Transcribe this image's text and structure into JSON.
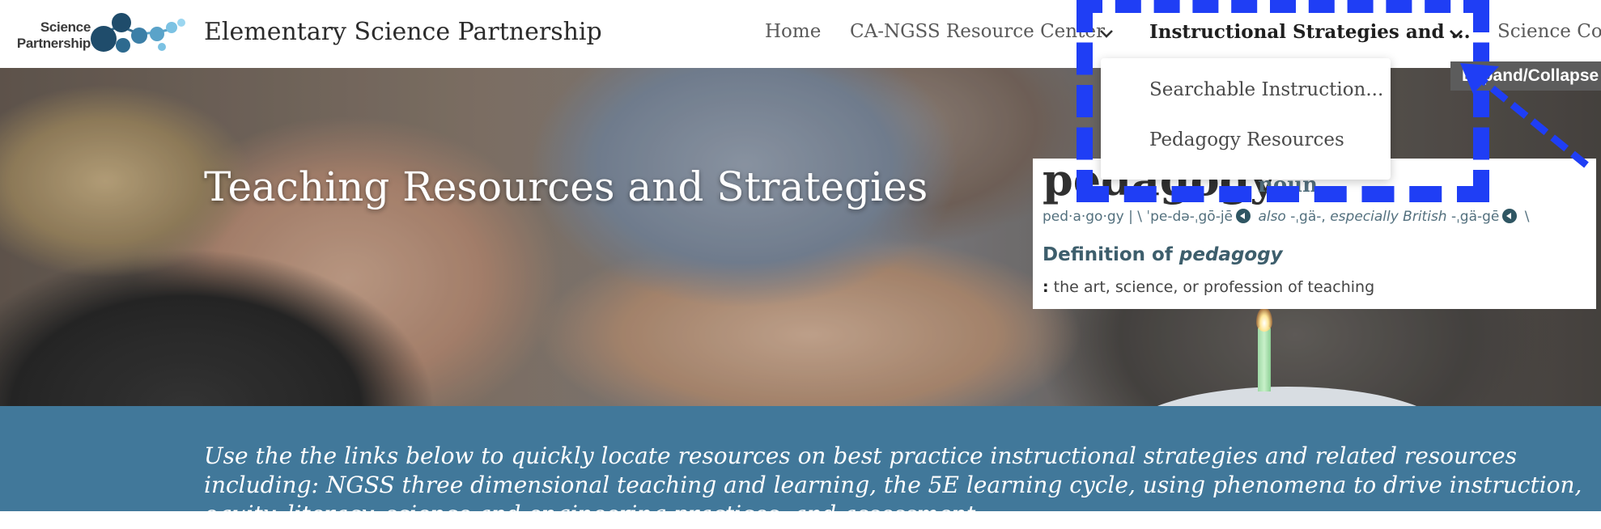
{
  "header": {
    "logo_line1": "Science",
    "logo_line2": "Partnership",
    "site_title": "Elementary Science Partnership",
    "nav": [
      {
        "label": "Home"
      },
      {
        "label": "CA-NGSS Resource Center"
      },
      {
        "label": "Instructional Strategies and ..."
      },
      {
        "label": "Science Con"
      }
    ]
  },
  "dropdown": {
    "items": [
      {
        "label": "Searchable Instruction..."
      },
      {
        "label": "Pedagogy Resources"
      }
    ]
  },
  "tooltip": "Expand/Collapse",
  "hero": {
    "title": "Teaching Resources and Strategies"
  },
  "definition": {
    "word": "pedagogy",
    "part_of_speech": "noun",
    "pron_syllables": "ped·a·go·gy",
    "pron_sep": "|",
    "pron_main": "\\ ˈpe-də-ˌgō-jē",
    "pron_also_label": "also",
    "pron_alt": "-ˌgä-,",
    "pron_british_label": "especially British",
    "pron_british": "-ˌgä-gē",
    "pron_end": "\\",
    "heading_prefix": "Definition of",
    "heading_word": "pedagogy",
    "sense_marker": ":",
    "sense_text": "the art, science, or profession of teaching"
  },
  "band": {
    "text": "Use the the links below to quickly locate resources on best practice instructional strategies and related resources including: NGSS three dimensional teaching and learning, the 5E learning cycle, using phenomena to drive instruction, equity, literacy, science and engineering practices, and assessment."
  },
  "colors": {
    "band": "#41789a",
    "annotation": "#1f3ef5",
    "tooltip_bg": "#5c5c5c",
    "definition_accent": "#53707e"
  }
}
